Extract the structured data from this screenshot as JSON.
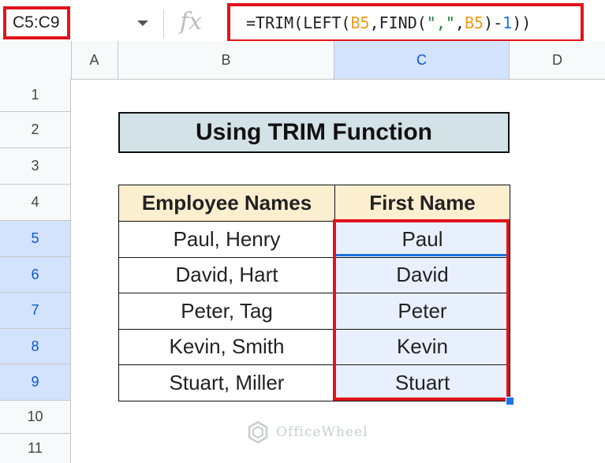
{
  "formula_bar": {
    "name_box": "C5:C9",
    "fx_label": "fx",
    "formula_parts": [
      {
        "text": "=TRIM(LEFT(",
        "style": "plain"
      },
      {
        "text": "B5",
        "style": "ref"
      },
      {
        "text": ",FIND(",
        "style": "plain"
      },
      {
        "text": "\",\"",
        "style": "str"
      },
      {
        "text": ",",
        "style": "plain"
      },
      {
        "text": "B5",
        "style": "ref"
      },
      {
        "text": ")-",
        "style": "plain"
      },
      {
        "text": "1",
        "style": "num"
      },
      {
        "text": "))",
        "style": "plain"
      }
    ]
  },
  "columns": [
    "A",
    "B",
    "C",
    "D"
  ],
  "rows": [
    "1",
    "2",
    "3",
    "4",
    "5",
    "6",
    "7",
    "8",
    "9",
    "10",
    "11"
  ],
  "sheet": {
    "title": "Using TRIM Function",
    "table": {
      "headers": [
        "Employee Names",
        "First Name"
      ],
      "rows": [
        [
          "Paul, Henry",
          "Paul"
        ],
        [
          "David, Hart",
          "David"
        ],
        [
          "Peter, Tag",
          "Peter"
        ],
        [
          "Kevin, Smith",
          "Kevin"
        ],
        [
          "Stuart, Miller",
          "Stuart"
        ]
      ]
    }
  },
  "watermark": "OfficeWheel",
  "colors": {
    "highlight_red": "#e0141c",
    "title_fill": "#d2e2e6",
    "header_fill": "#fcefd0",
    "selection_fill": "#e8f0fe",
    "selection_blue": "#1a73e8"
  },
  "icons": {
    "name_box_dropdown": "chevron-down-icon",
    "fx": "function-icon",
    "watermark": "officewheel-logo-icon"
  }
}
